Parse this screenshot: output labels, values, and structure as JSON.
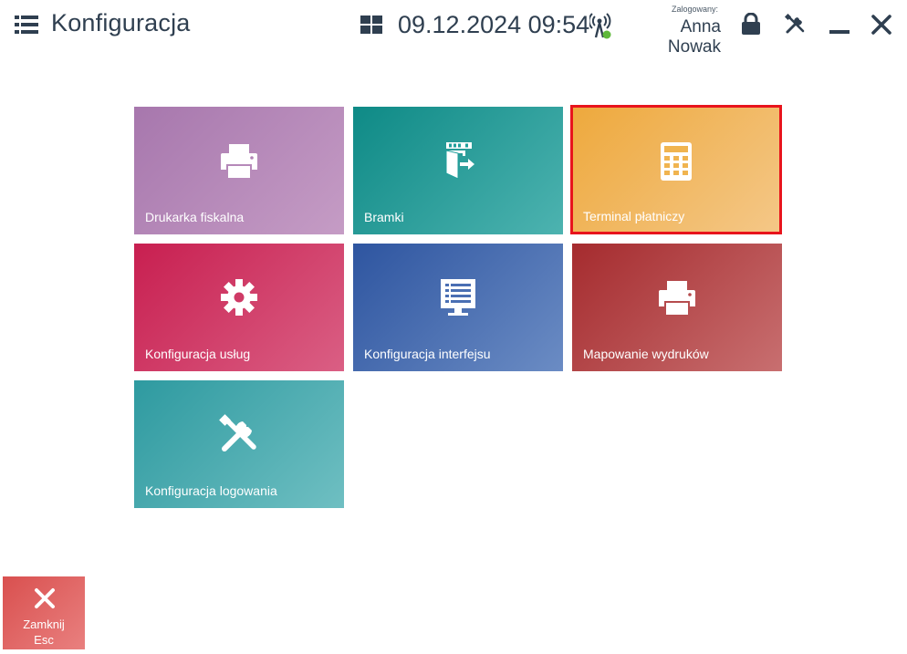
{
  "header": {
    "title": "Konfiguracja",
    "datetime": "09.12.2024 09:54",
    "logged_label": "Zalogowany:",
    "user_name": "Anna Nowak"
  },
  "tiles": [
    {
      "label": "Drukarka fiskalna",
      "icon": "printer-icon",
      "color": "#b285b5"
    },
    {
      "label": "Bramki",
      "icon": "gate-icon",
      "color": "#20a09c"
    },
    {
      "label": "Terminal płatniczy",
      "icon": "calculator-icon",
      "color": "#f0b450",
      "highlight": "#e8141c"
    },
    {
      "label": "Konfiguracja usług",
      "icon": "gear-icon",
      "color": "#cf3a66"
    },
    {
      "label": "Konfiguracja interfejsu",
      "icon": "monitor-icon",
      "color": "#4a6fb3"
    },
    {
      "label": "Mapowanie wydruków",
      "icon": "printer-icon",
      "color": "#b54a4c"
    },
    {
      "label": "Konfiguracja logowania",
      "icon": "tools-icon",
      "color": "#4aacb0"
    }
  ],
  "close_button": {
    "label": "Zamknij",
    "shortcut": "Esc",
    "color": "#e06665"
  },
  "status": {
    "connection_color": "#5fb83a"
  }
}
